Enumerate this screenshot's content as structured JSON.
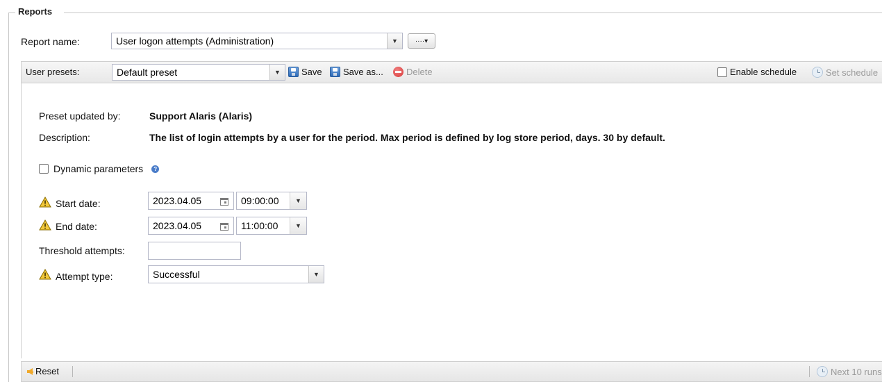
{
  "section": {
    "legend": "Reports"
  },
  "report": {
    "name_label": "Report name:",
    "name_value": "User logon attempts (Administration)",
    "more_button": "····▾"
  },
  "toolbar": {
    "presets_label": "User presets:",
    "preset_value": "Default preset",
    "save_label": "Save",
    "save_as_label": "Save as...",
    "delete_label": "Delete",
    "enable_schedule_label": "Enable schedule",
    "set_schedule_label": "Set schedule"
  },
  "info": {
    "updated_by_label": "Preset updated by:",
    "updated_by_value": "Support Alaris (Alaris)",
    "description_label": "Description:",
    "description_value": "The list of login attempts by a user for the period. Max period is defined by log store period, days. 30 by default."
  },
  "params": {
    "dynamic_label": "Dynamic parameters",
    "start_label": "Start date:",
    "start_date": "2023.04.05",
    "start_time": "09:00:00",
    "end_label": "End date:",
    "end_date": "2023.04.05",
    "end_time": "11:00:00",
    "threshold_label": "Threshold attempts:",
    "threshold_value": "",
    "attempt_label": "Attempt type:",
    "attempt_value": "Successful"
  },
  "footer": {
    "reset_label": "Reset",
    "next_runs_label": "Next 10 runs"
  },
  "colors": {
    "toolbar_bg": "#eeeeee",
    "warn": "#f2c83a",
    "save_icon": "#2e6bb8",
    "delete_icon": "#d93838",
    "reset_icon": "#f0a92a"
  }
}
